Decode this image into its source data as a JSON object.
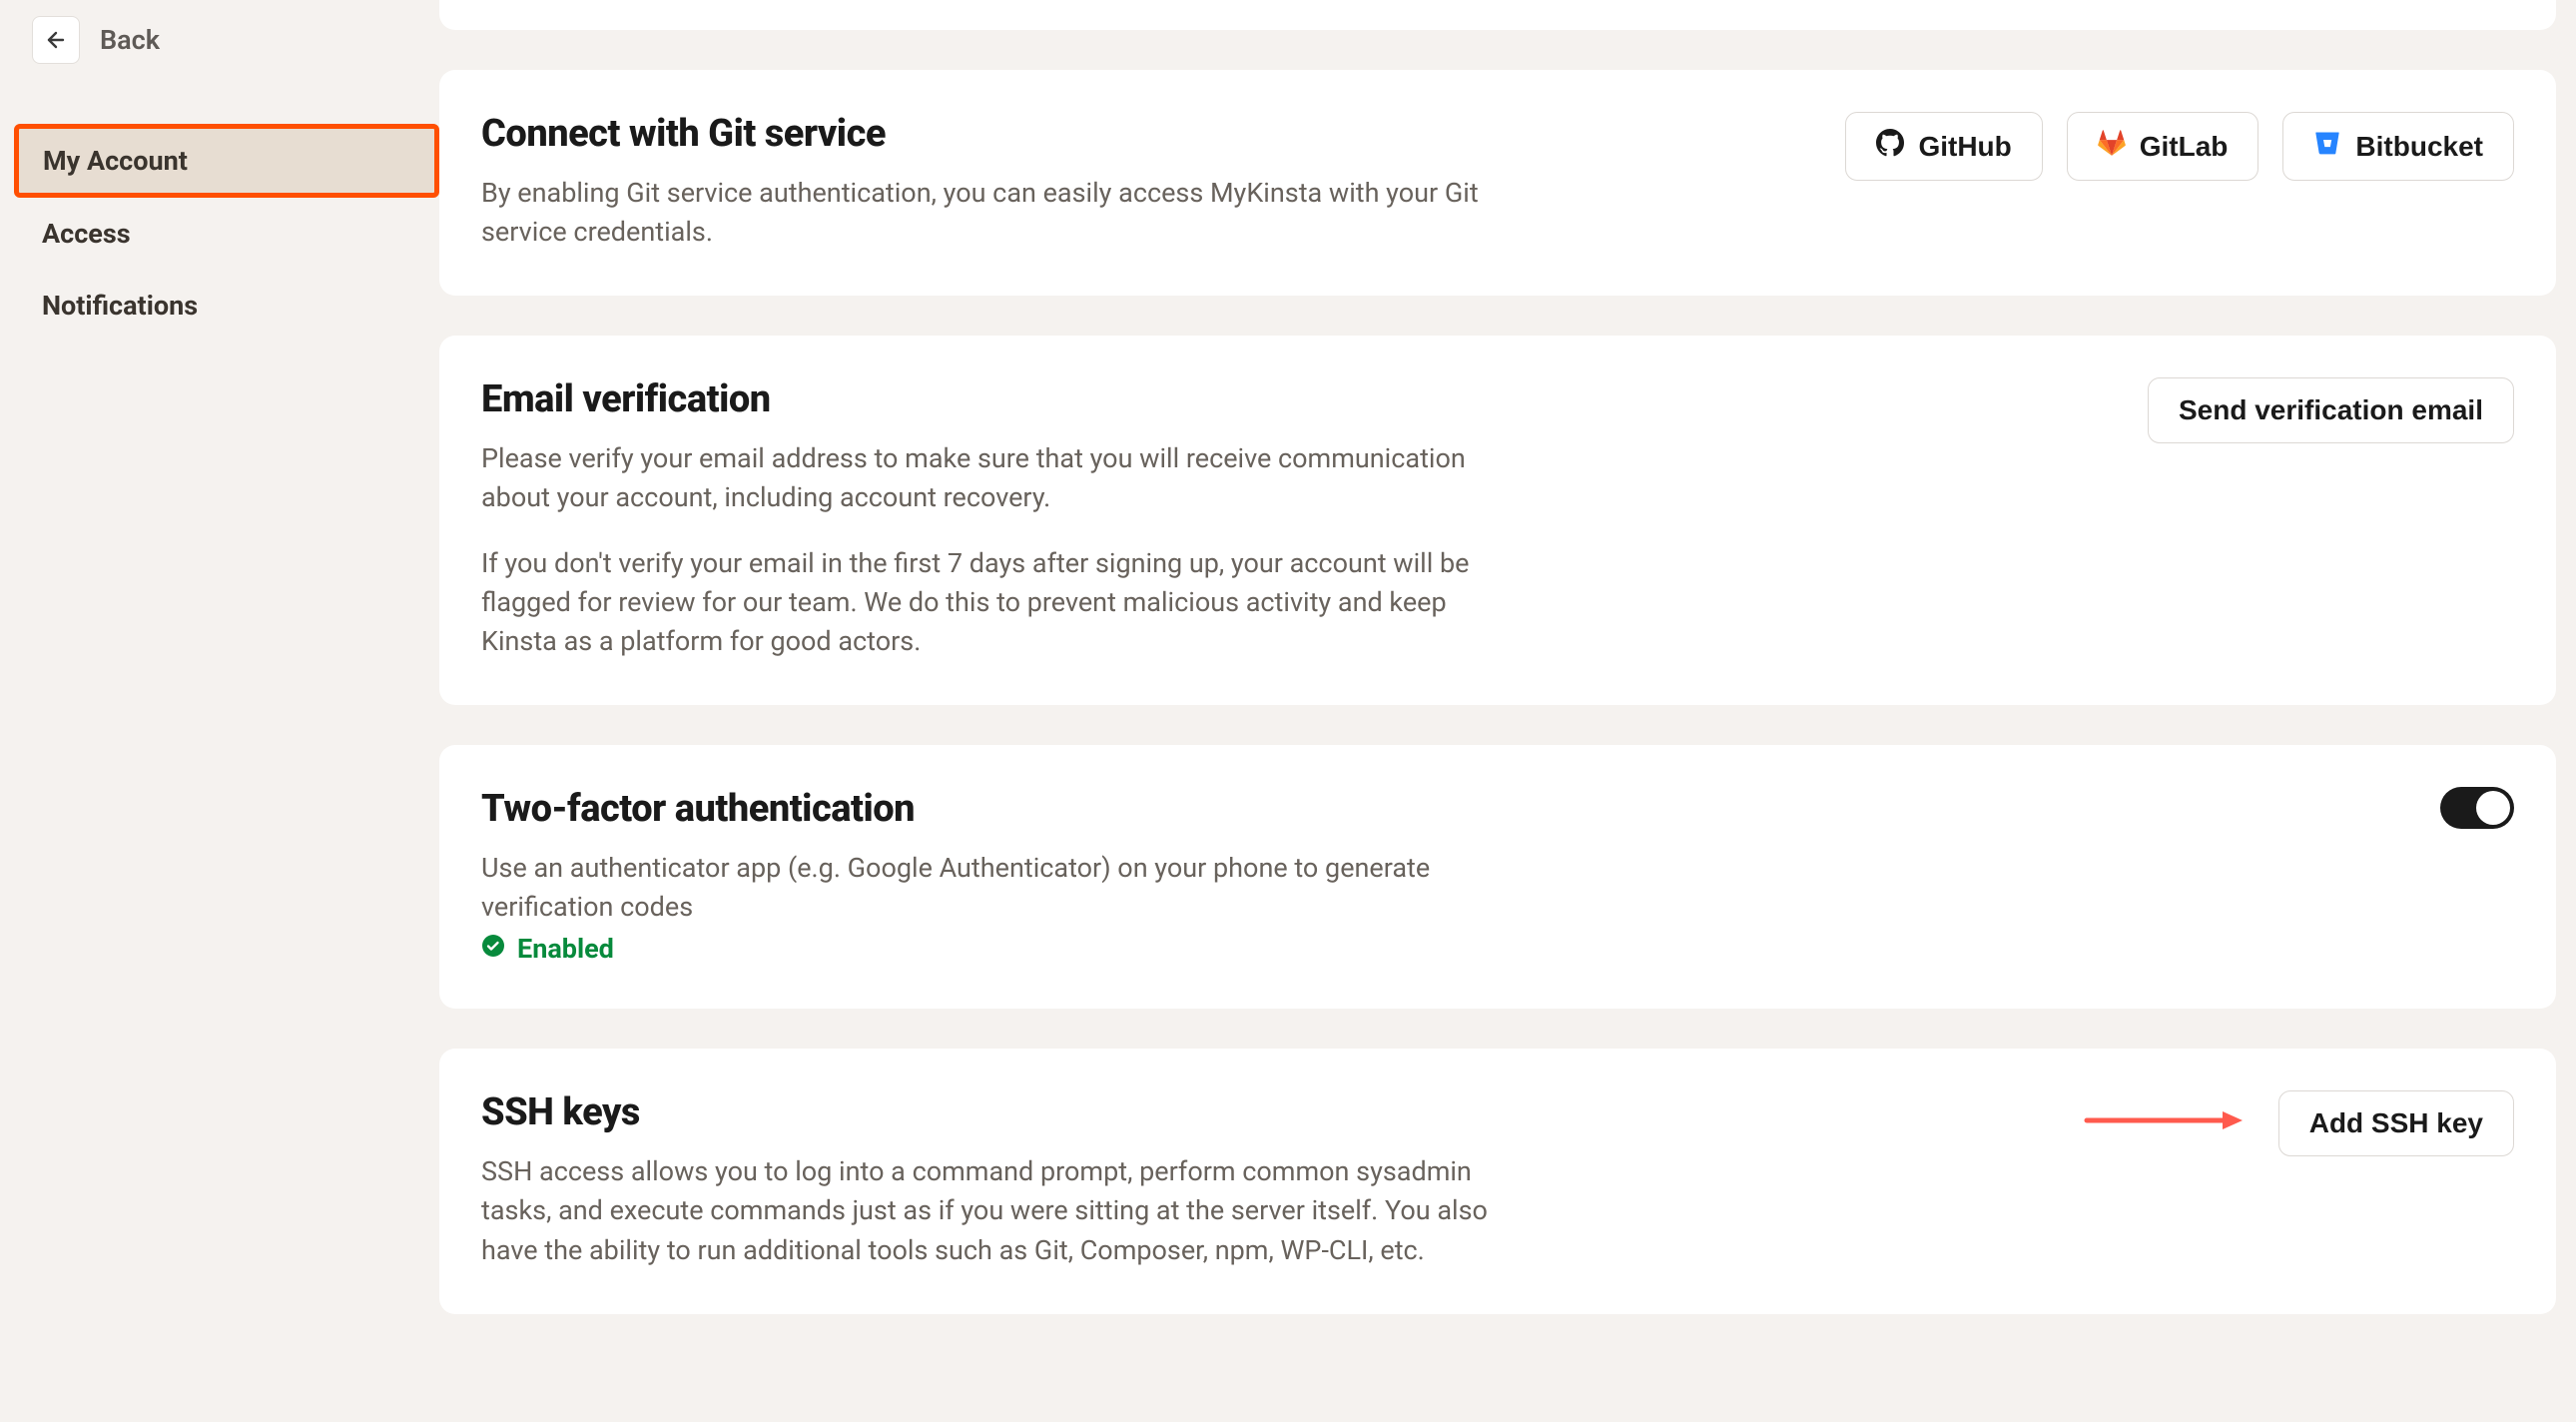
{
  "back_label": "Back",
  "sidebar": {
    "items": [
      {
        "label": "My Account",
        "active": true
      },
      {
        "label": "Access",
        "active": false
      },
      {
        "label": "Notifications",
        "active": false
      }
    ]
  },
  "cards": {
    "git": {
      "title": "Connect with Git service",
      "desc": "By enabling Git service authentication, you can easily access MyKinsta with your Git service credentials.",
      "buttons": {
        "github": "GitHub",
        "gitlab": "GitLab",
        "bitbucket": "Bitbucket"
      }
    },
    "email": {
      "title": "Email verification",
      "desc1": "Please verify your email address to make sure that you will receive communication about your account, including account recovery.",
      "desc2": "If you don't verify your email in the first 7 days after signing up, your account will be flagged for review for our team. We do this to prevent malicious activity and keep Kinsta as a platform for good actors.",
      "button": "Send verification email"
    },
    "twofa": {
      "title": "Two-factor authentication",
      "desc": "Use an authenticator app (e.g. Google Authenticator) on your phone to generate verification codes",
      "status": "Enabled"
    },
    "ssh": {
      "title": "SSH keys",
      "desc": "SSH access allows you to log into a command prompt, perform common sysadmin tasks, and execute commands just as if you were sitting at the server itself. You also have the ability to run additional tools such as Git, Composer, npm, WP-CLI, etc.",
      "button": "Add SSH key"
    }
  }
}
